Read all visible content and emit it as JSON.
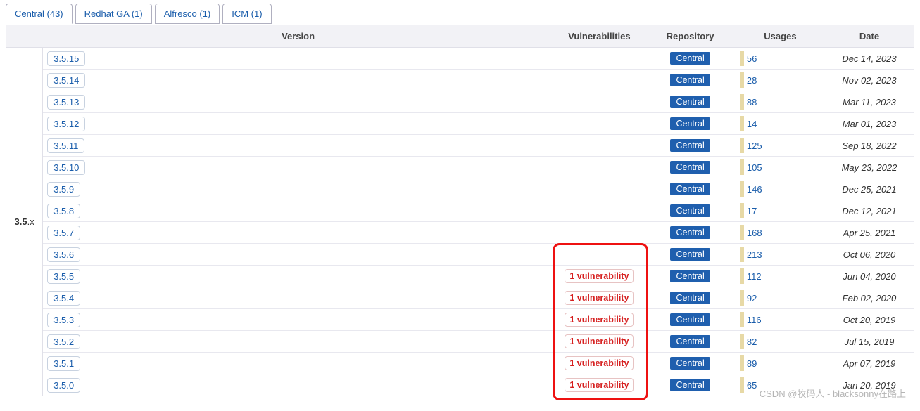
{
  "tabs": [
    {
      "label": "Central (43)",
      "active": true
    },
    {
      "label": "Redhat GA (1)",
      "active": false
    },
    {
      "label": "Alfresco (1)",
      "active": false
    },
    {
      "label": "ICM (1)",
      "active": false
    }
  ],
  "columns": {
    "group": "",
    "version": "Version",
    "vulnerabilities": "Vulnerabilities",
    "repository": "Repository",
    "usages": "Usages",
    "date": "Date"
  },
  "group": {
    "major": "3.5",
    "suffix": ".x"
  },
  "rows": [
    {
      "version": "3.5.15",
      "vuln": "",
      "repo": "Central",
      "usages": "56",
      "date": "Dec 14, 2023"
    },
    {
      "version": "3.5.14",
      "vuln": "",
      "repo": "Central",
      "usages": "28",
      "date": "Nov 02, 2023"
    },
    {
      "version": "3.5.13",
      "vuln": "",
      "repo": "Central",
      "usages": "88",
      "date": "Mar 11, 2023"
    },
    {
      "version": "3.5.12",
      "vuln": "",
      "repo": "Central",
      "usages": "14",
      "date": "Mar 01, 2023"
    },
    {
      "version": "3.5.11",
      "vuln": "",
      "repo": "Central",
      "usages": "125",
      "date": "Sep 18, 2022"
    },
    {
      "version": "3.5.10",
      "vuln": "",
      "repo": "Central",
      "usages": "105",
      "date": "May 23, 2022"
    },
    {
      "version": "3.5.9",
      "vuln": "",
      "repo": "Central",
      "usages": "146",
      "date": "Dec 25, 2021"
    },
    {
      "version": "3.5.8",
      "vuln": "",
      "repo": "Central",
      "usages": "17",
      "date": "Dec 12, 2021"
    },
    {
      "version": "3.5.7",
      "vuln": "",
      "repo": "Central",
      "usages": "168",
      "date": "Apr 25, 2021"
    },
    {
      "version": "3.5.6",
      "vuln": "",
      "repo": "Central",
      "usages": "213",
      "date": "Oct 06, 2020"
    },
    {
      "version": "3.5.5",
      "vuln": "1 vulnerability",
      "repo": "Central",
      "usages": "112",
      "date": "Jun 04, 2020"
    },
    {
      "version": "3.5.4",
      "vuln": "1 vulnerability",
      "repo": "Central",
      "usages": "92",
      "date": "Feb 02, 2020"
    },
    {
      "version": "3.5.3",
      "vuln": "1 vulnerability",
      "repo": "Central",
      "usages": "116",
      "date": "Oct 20, 2019"
    },
    {
      "version": "3.5.2",
      "vuln": "1 vulnerability",
      "repo": "Central",
      "usages": "82",
      "date": "Jul 15, 2019"
    },
    {
      "version": "3.5.1",
      "vuln": "1 vulnerability",
      "repo": "Central",
      "usages": "89",
      "date": "Apr 07, 2019"
    },
    {
      "version": "3.5.0",
      "vuln": "1 vulnerability",
      "repo": "Central",
      "usages": "65",
      "date": "Jan 20, 2019"
    }
  ],
  "watermark": "CSDN @牧码人 - blacksonny在路上"
}
